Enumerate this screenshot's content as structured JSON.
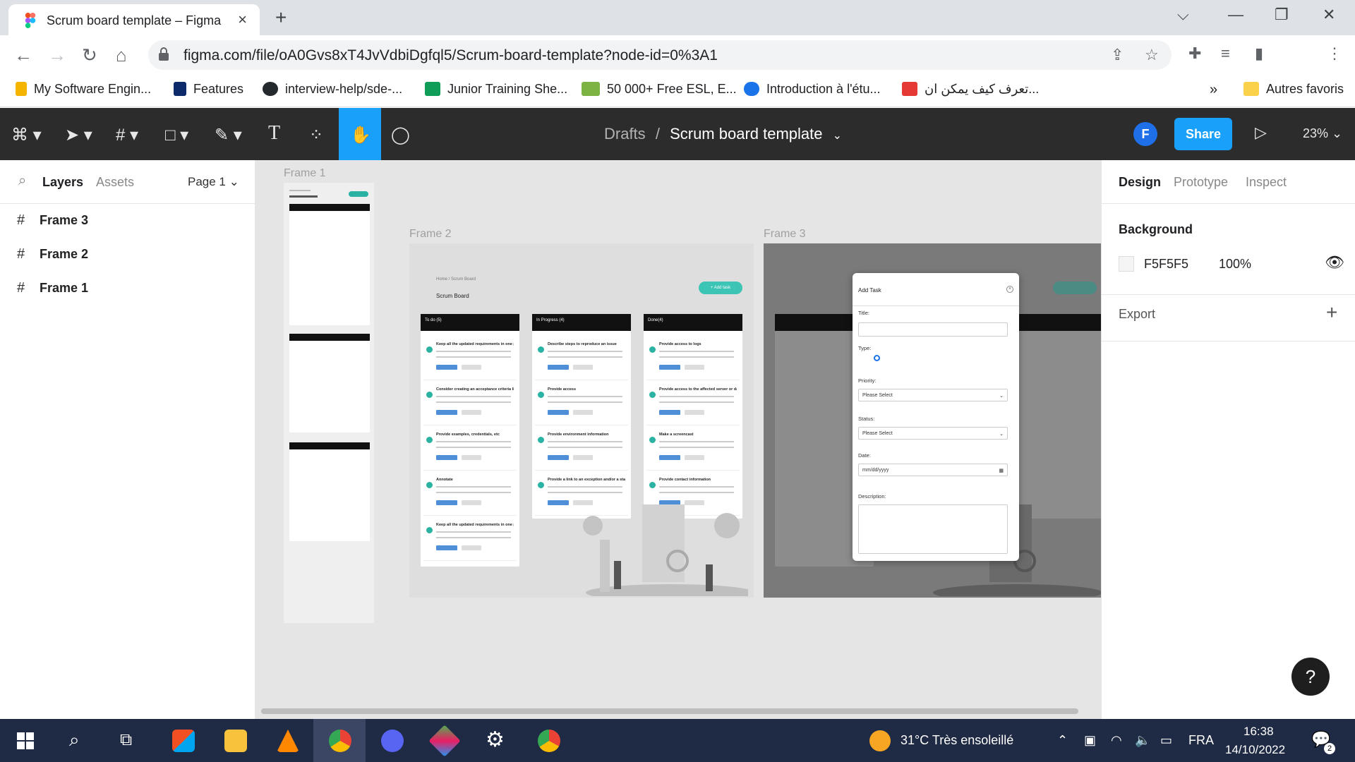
{
  "browser": {
    "tab_title": "Scrum board template – Figma",
    "url": "figma.com/file/oA0Gvs8xT4JvVdbiDgfql5/Scrum-board-template?node-id=0%3A1",
    "bookmarks": [
      {
        "label": "My Software Engin...",
        "color": "#f4b400"
      },
      {
        "label": "Features",
        "color": "#0d2a6b"
      },
      {
        "label": "interview-help/sde-...",
        "color": "#24292e"
      },
      {
        "label": "Junior Training She...",
        "color": "#0f9d58"
      },
      {
        "label": "50 000+ Free ESL, E...",
        "color": "#7cb342"
      },
      {
        "label": "Introduction à l'étu...",
        "color": "#1a73e8"
      },
      {
        "label": "تعرف كيف يمكن ان...",
        "color": "#e53935"
      }
    ],
    "more_bookmarks": "»",
    "other_favorites": "Autres favoris"
  },
  "figma": {
    "breadcrumb_root": "Drafts",
    "breadcrumb_sep": "/",
    "document_title": "Scrum board template",
    "avatar_initial": "F",
    "share_label": "Share",
    "zoom_label": "23%",
    "left_tabs": {
      "layers": "Layers",
      "assets": "Assets",
      "page": "Page 1"
    },
    "layers": [
      "Frame 3",
      "Frame 2",
      "Frame 1"
    ],
    "right_tabs": {
      "design": "Design",
      "prototype": "Prototype",
      "inspect": "Inspect"
    },
    "background_heading": "Background",
    "background_hex": "F5F5F5",
    "background_opacity": "100%",
    "export_heading": "Export",
    "help": "?"
  },
  "canvas": {
    "frame_labels": [
      "Frame 1",
      "Frame 2",
      "Frame 3"
    ],
    "frame2": {
      "breadcrumb": "Home  /  Scrum Board",
      "title": "Scrum Board",
      "add_button": "+ Add task",
      "columns": [
        {
          "title": "To do (5)",
          "tasks": [
            "Keep all the updated requirements in one place",
            "Consider creating an acceptance criteria list",
            "Provide examples, credentials, etc",
            "Annotate",
            "Keep all the updated requirements in one place"
          ]
        },
        {
          "title": "In Progress (4)",
          "tasks": [
            "Describe steps to reproduce an issue",
            "Provide access",
            "Provide environment information",
            "Provide a link to an exception and/or a stack trace"
          ]
        },
        {
          "title": "Done(4)",
          "tasks": [
            "Provide access to logs",
            "Provide access to the affected server or database dump",
            "Make a screencast",
            "Provide contact information"
          ]
        }
      ]
    },
    "dialog": {
      "title": "Add Task",
      "title_label": "Title:",
      "type_label": "Type:",
      "priority_label": "Priority:",
      "priority_value": "Please Select",
      "status_label": "Status:",
      "status_value": "Please Select",
      "date_label": "Date:",
      "date_value": "mm/dd/yyyy",
      "description_label": "Description:"
    }
  },
  "taskbar": {
    "weather": "31°C  Très ensoleillé",
    "lang": "FRA",
    "time": "16:38",
    "date": "14/10/2022",
    "notifications": "2"
  }
}
